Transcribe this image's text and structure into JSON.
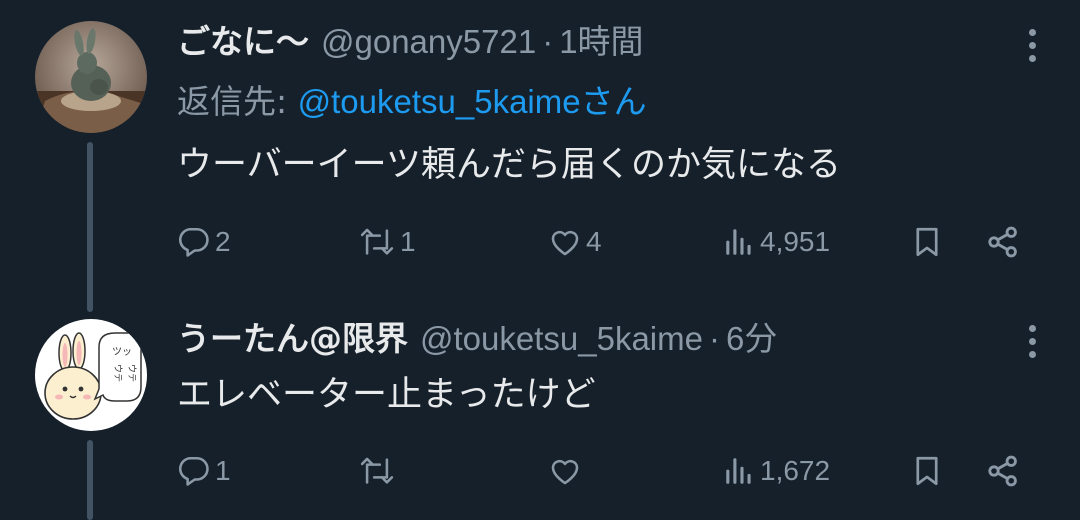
{
  "tweets": [
    {
      "display_name": "ごなに〜",
      "handle": "@gonany5721",
      "separator": "·",
      "time": "1時間",
      "reply_label": "返信先: ",
      "reply_handle": "@touketsu_5kaime",
      "reply_suffix": "さん",
      "text": "ウーバーイーツ頼んだら届くのか気になる",
      "replies": "2",
      "retweets": "1",
      "likes": "4",
      "views": "4,951",
      "avatar": "rabbit-figurine-photo"
    },
    {
      "display_name": "うーたん@限界",
      "handle": "@touketsu_5kaime",
      "separator": "·",
      "time": "6分",
      "text": "エレベーター止まったけど",
      "replies": "1",
      "retweets": "",
      "likes": "",
      "views": "1,672",
      "avatar": "cartoon-rabbit-illustration",
      "avatar_bubble_text": "ツッ ウテウテ"
    }
  ],
  "icons": {
    "reply": "reply-icon",
    "retweet": "retweet-icon",
    "like": "heart-icon",
    "views": "views-icon",
    "bookmark": "bookmark-icon",
    "share": "share-icon",
    "more": "more-icon"
  },
  "colors": {
    "background": "#15202b",
    "text": "#e7e9ea",
    "muted": "#8b98a5",
    "link": "#1d9bf0",
    "thread_line": "#425364"
  }
}
